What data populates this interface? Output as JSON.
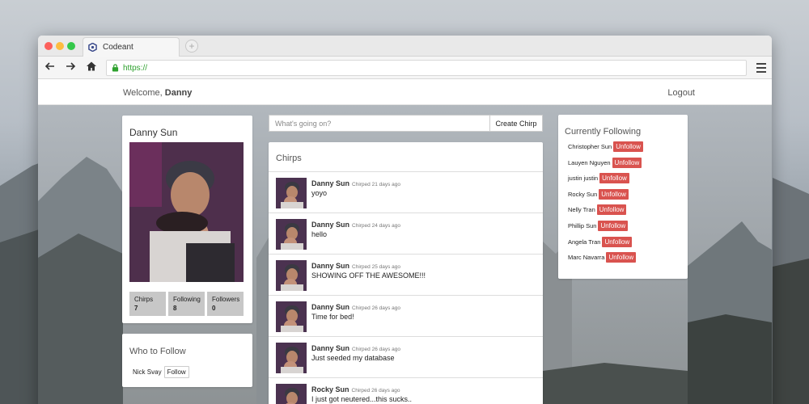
{
  "browser": {
    "tab_title": "Codeant",
    "new_tab_symbol": "+",
    "url": "https://",
    "nav": {
      "back_icon": "arrow-left-icon",
      "forward_icon": "arrow-right-icon",
      "home_icon": "home-icon",
      "menu_icon": "hamburger-menu-icon"
    }
  },
  "header": {
    "welcome_prefix": "Welcome, ",
    "user_name": "Danny",
    "logout_label": "Logout"
  },
  "profile": {
    "name": "Danny Sun",
    "stats": [
      {
        "label": "Chirps",
        "value": "7"
      },
      {
        "label": "Following",
        "value": "8"
      },
      {
        "label": "Followers",
        "value": "0"
      }
    ]
  },
  "who_to_follow": {
    "title": "Who to Follow",
    "items": [
      {
        "name": "Nick Svay",
        "button": "Follow"
      }
    ]
  },
  "composer": {
    "placeholder": "What's going on?",
    "button_label": "Create Chirp"
  },
  "chirps": {
    "title": "Chirps",
    "items": [
      {
        "author": "Danny Sun",
        "meta": "Chirped 21 days ago",
        "text": "yoyo"
      },
      {
        "author": "Danny Sun",
        "meta": "Chirped 24 days ago",
        "text": "hello"
      },
      {
        "author": "Danny Sun",
        "meta": "Chirped 25 days ago",
        "text": "SHOWING OFF THE AWESOME!!!"
      },
      {
        "author": "Danny Sun",
        "meta": "Chirped 26 days ago",
        "text": "Time for bed!"
      },
      {
        "author": "Danny Sun",
        "meta": "Chirped 26 days ago",
        "text": "Just seeded my database"
      },
      {
        "author": "Rocky Sun",
        "meta": "Chirped 26 days ago",
        "text": "I just got neutered...this sucks.."
      }
    ]
  },
  "following": {
    "title": "Currently Following",
    "button_label": "Unfollow",
    "people": [
      "Christopher Sun",
      "Lauyen Nguyen",
      "justin justin",
      "Rocky Sun",
      "Nelly Tran",
      "Phillip Sun",
      "Angela Tran",
      "Marc Navarra"
    ]
  },
  "colors": {
    "unfollow_button": "#d9534f",
    "secure_url": "#2ea12e"
  }
}
